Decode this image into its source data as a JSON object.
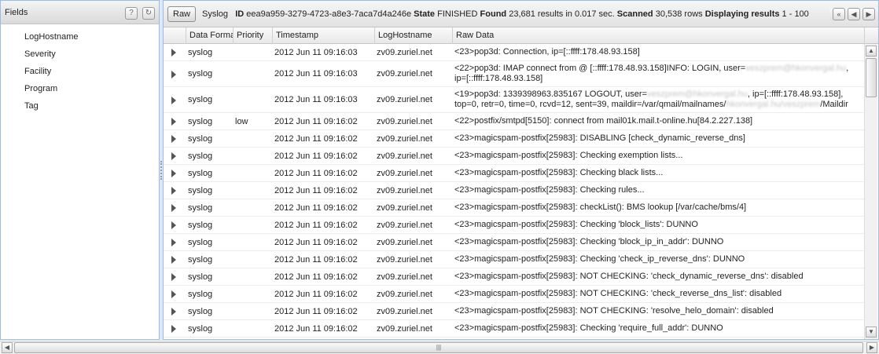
{
  "fields_panel": {
    "title": "Fields",
    "help_icon": "question-icon",
    "refresh_icon": "refresh-icon",
    "items": [
      "LogHostname",
      "Severity",
      "Facility",
      "Program",
      "Tag"
    ]
  },
  "toolbar": {
    "raw_label": "Raw",
    "source": "Syslog",
    "id_label": "ID",
    "id_value": "eea9a959-3279-4723-a8e3-7aca7d4a246e",
    "state_label": "State",
    "state_value": "FINISHED",
    "found_label": "Found",
    "found_value": "23,681 results in 0.017 sec.",
    "scanned_label": "Scanned",
    "scanned_value": "30,538 rows",
    "displaying_label": "Displaying results",
    "displaying_value": "1 - 100"
  },
  "columns": [
    "Data Format",
    "Priority",
    "Timestamp",
    "LogHostname",
    "Raw Data"
  ],
  "rows": [
    {
      "format": "syslog",
      "priority": "",
      "timestamp": "2012 Jun 11 09:16:03",
      "host": "zv09.zuriel.net",
      "raw": "<23>pop3d: Connection, ip=[::ffff:178.48.93.158]"
    },
    {
      "format": "syslog",
      "priority": "",
      "timestamp": "2012 Jun 11 09:16:03",
      "host": "zv09.zuriel.net",
      "raw_pre": "<22>pop3d: IMAP connect from @ [::ffff:178.48.93.158]INFO: LOGIN, user=",
      "raw_blur": "veszprem@hkonvergal.hu",
      "raw_post": ", ip=[::ffff:178.48.93.158]"
    },
    {
      "format": "syslog",
      "priority": "",
      "timestamp": "2012 Jun 11 09:16:03",
      "host": "zv09.zuriel.net",
      "raw_pre": "<19>pop3d: 1339398963.835167 LOGOUT, user=",
      "raw_blur": "veszprem@hkonvergal.hu",
      "raw_post": ", ip=[::ffff:178.48.93.158], top=0, retr=0, time=0, rcvd=12, sent=39, maildir=/var/qmail/mailnames/",
      "raw_blur2": "hkonvergal.hu/veszprem",
      "raw_post2": "/Maildir"
    },
    {
      "format": "syslog",
      "priority": "low",
      "timestamp": "2012 Jun 11 09:16:02",
      "host": "zv09.zuriel.net",
      "raw": "<22>postfix/smtpd[5150]: connect from mail01k.mail.t-online.hu[84.2.227.138]"
    },
    {
      "format": "syslog",
      "priority": "",
      "timestamp": "2012 Jun 11 09:16:02",
      "host": "zv09.zuriel.net",
      "raw": "<23>magicspam-postfix[25983]: DISABLING [check_dynamic_reverse_dns]"
    },
    {
      "format": "syslog",
      "priority": "",
      "timestamp": "2012 Jun 11 09:16:02",
      "host": "zv09.zuriel.net",
      "raw": "<23>magicspam-postfix[25983]: Checking exemption lists..."
    },
    {
      "format": "syslog",
      "priority": "",
      "timestamp": "2012 Jun 11 09:16:02",
      "host": "zv09.zuriel.net",
      "raw": "<23>magicspam-postfix[25983]: Checking black lists..."
    },
    {
      "format": "syslog",
      "priority": "",
      "timestamp": "2012 Jun 11 09:16:02",
      "host": "zv09.zuriel.net",
      "raw": "<23>magicspam-postfix[25983]: Checking rules..."
    },
    {
      "format": "syslog",
      "priority": "",
      "timestamp": "2012 Jun 11 09:16:02",
      "host": "zv09.zuriel.net",
      "raw": "<23>magicspam-postfix[25983]: checkList(): BMS lookup [/var/cache/bms/4]"
    },
    {
      "format": "syslog",
      "priority": "",
      "timestamp": "2012 Jun 11 09:16:02",
      "host": "zv09.zuriel.net",
      "raw": "<23>magicspam-postfix[25983]: Checking 'block_lists': DUNNO"
    },
    {
      "format": "syslog",
      "priority": "",
      "timestamp": "2012 Jun 11 09:16:02",
      "host": "zv09.zuriel.net",
      "raw": "<23>magicspam-postfix[25983]: Checking 'block_ip_in_addr': DUNNO"
    },
    {
      "format": "syslog",
      "priority": "",
      "timestamp": "2012 Jun 11 09:16:02",
      "host": "zv09.zuriel.net",
      "raw": "<23>magicspam-postfix[25983]: Checking 'check_ip_reverse_dns': DUNNO"
    },
    {
      "format": "syslog",
      "priority": "",
      "timestamp": "2012 Jun 11 09:16:02",
      "host": "zv09.zuriel.net",
      "raw": "<23>magicspam-postfix[25983]: NOT CHECKING: 'check_dynamic_reverse_dns': disabled"
    },
    {
      "format": "syslog",
      "priority": "",
      "timestamp": "2012 Jun 11 09:16:02",
      "host": "zv09.zuriel.net",
      "raw": "<23>magicspam-postfix[25983]: NOT CHECKING: 'check_reverse_dns_list': disabled"
    },
    {
      "format": "syslog",
      "priority": "",
      "timestamp": "2012 Jun 11 09:16:02",
      "host": "zv09.zuriel.net",
      "raw": "<23>magicspam-postfix[25983]: NOT CHECKING: 'resolve_helo_domain': disabled"
    },
    {
      "format": "syslog",
      "priority": "",
      "timestamp": "2012 Jun 11 09:16:02",
      "host": "zv09.zuriel.net",
      "raw": "<23>magicspam-postfix[25983]: Checking 'require_full_addr': DUNNO"
    }
  ]
}
